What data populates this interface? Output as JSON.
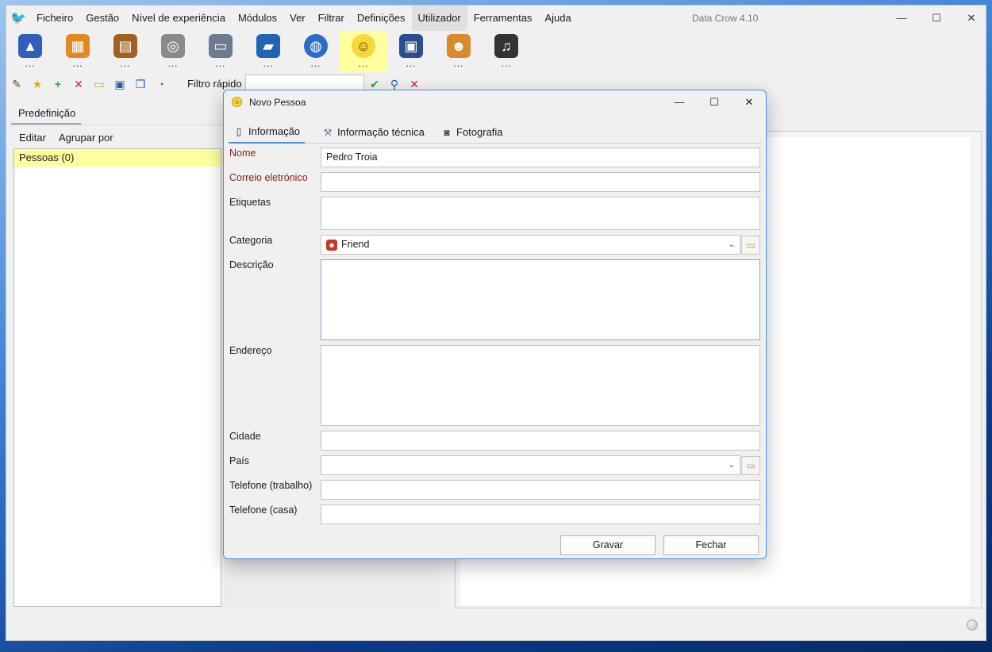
{
  "app": {
    "title": "Data Crow 4.10",
    "menu": [
      "Ficheiro",
      "Gestão",
      "Nível de experiência",
      "Módulos",
      "Ver",
      "Filtrar",
      "Definições",
      "Utilizador",
      "Ferramentas",
      "Ajuda"
    ],
    "active_menu": "Utilizador"
  },
  "modules": [
    {
      "icon": "wizard-hat-icon",
      "label": "..."
    },
    {
      "icon": "software-box-icon",
      "label": "..."
    },
    {
      "icon": "book-cabinet-icon",
      "label": "..."
    },
    {
      "icon": "film-reel-icon",
      "label": "..."
    },
    {
      "icon": "picture-icon",
      "label": "..."
    },
    {
      "icon": "blue-book-icon",
      "label": "..."
    },
    {
      "icon": "globe-icon",
      "label": "..."
    },
    {
      "icon": "smiley-icon",
      "label": "..."
    },
    {
      "icon": "floppy-disk-icon",
      "label": "..."
    },
    {
      "icon": "users-icon",
      "label": "..."
    },
    {
      "icon": "headphones-icon",
      "label": "..."
    }
  ],
  "toolbar": {
    "quick_filter_label": "Filtro rápido",
    "quick_filter_value": ""
  },
  "left_panel": {
    "tab": "Predefinição",
    "menu": [
      "Editar",
      "Agrupar por"
    ],
    "tree_items": [
      "Pessoas (0)"
    ]
  },
  "dialog": {
    "title": "Novo Pessoa",
    "tabs": [
      "Informação",
      "Informação técnica",
      "Fotografia"
    ],
    "fields": {
      "nome_label": "Nome",
      "nome_value": "Pedro Troia",
      "email_label": "Correio eletrónico",
      "email_value": "",
      "etiquetas_label": "Etiquetas",
      "etiquetas_value": "",
      "categoria_label": "Categoria",
      "categoria_value": "Friend",
      "descricao_label": "Descrição",
      "descricao_value": "",
      "endereco_label": "Endereço",
      "endereco_value": "",
      "cidade_label": "Cidade",
      "cidade_value": "",
      "pais_label": "País",
      "pais_value": "",
      "tel_trabalho_label": "Telefone (trabalho)",
      "tel_trabalho_value": "",
      "tel_casa_label": "Telefone (casa)",
      "tel_casa_value": ""
    },
    "buttons": {
      "save": "Gravar",
      "close": "Fechar"
    }
  },
  "colors": {
    "selected_highlight": "#ffff9e",
    "required_label": "#8b1a1a",
    "dialog_border": "#4a90d8"
  }
}
